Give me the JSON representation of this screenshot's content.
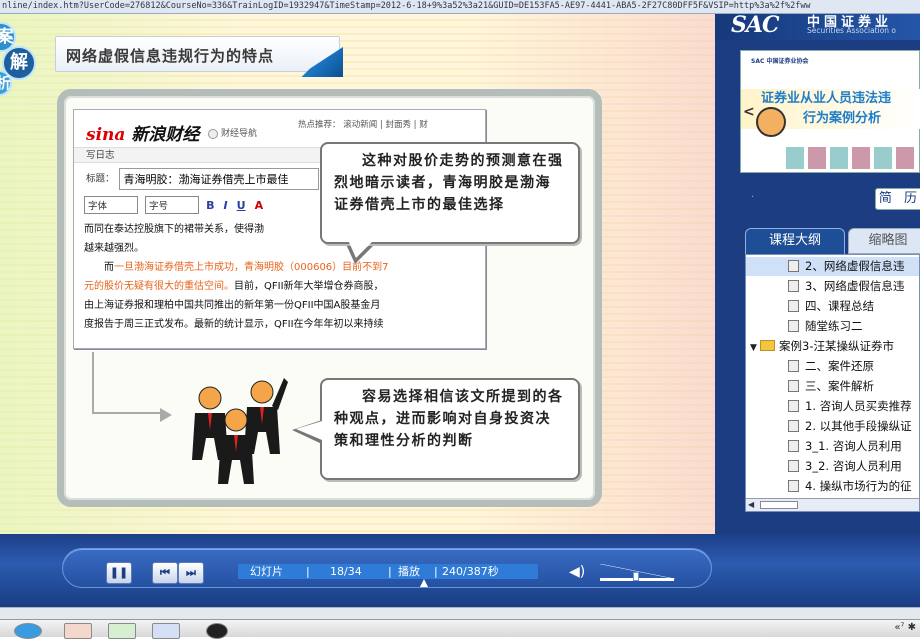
{
  "browser": {
    "url": "nline/index.htm?UserCode=276812&CourseNo=336&TrainLogID=1932947&TimeStamp=2012-6-18+9%3a52%3a21&GUID=DE153FA5-AE97-4441-ABA5-2F27C80DFF5F&VSIP=http%3a%2f%2fww"
  },
  "slide": {
    "case_chars": [
      "案",
      "解",
      "析"
    ],
    "title": "网络虚假信息违规行为的特点",
    "screenshot": {
      "logo_sina": "sina",
      "logo_rest": "新浪财经",
      "fin_nav": "财经导航",
      "hot_links": "热点推荐： 滚动新闻 | 封面秀 | 财",
      "write_blog": "写日志",
      "title_label": "标题：",
      "title_value": "青海明胶：渤海证券借壳上市最佳",
      "font_select": "字体",
      "size_select": "字号",
      "tb_bold": "B",
      "tb_italic": "I",
      "tb_underline": "U",
      "tb_color": "A",
      "line1": "而同在泰达控股旗下的裙带关系，使得渤",
      "line2": "越来越强烈。",
      "line3_pre": "而",
      "line3_red": "一旦渤海证券借壳上市成功，青海明胶（000606）目前不到7",
      "line4_red": "元的股价无疑有很大的重估空间。",
      "line4_rest": "目前，QFII新年大举增仓券商股，",
      "line5": "由上海证券报和理柏中国共同推出的新年第一份QFII中国A股基金月",
      "line6": "度报告于周三正式发布。最新的统计显示，QFII在今年年初以来持续"
    },
    "callout1": "这种对股价走势的预测意在强烈地暗示读者，青海明胶是渤海证券借壳上市的最佳选择",
    "callout2": "容易选择相信该文所提到的各种观点，进而影响对自身投资决策和理性分析的判断"
  },
  "sidebar": {
    "sac_logo": "SAC",
    "sac_cn": "中国证券业",
    "sac_en": "Securities Association o",
    "thumb_small": "SAC 中国证券业协会",
    "thumb_title1": "证券业从业人员违法违",
    "thumb_title2": "行为案例分析",
    "prev_arrow": "<",
    "simple_btn": "简 历",
    "dot": "·",
    "tab_outline": "课程大纲",
    "tab_thumbs": "缩略图",
    "tree": [
      {
        "label": "2、网络虚假信息违",
        "type": "page",
        "indent": 1,
        "highlight": true
      },
      {
        "label": "3、网络虚假信息违",
        "type": "page",
        "indent": 1,
        "highlight": false
      },
      {
        "label": "四、课程总结",
        "type": "page",
        "indent": 1,
        "highlight": false
      },
      {
        "label": "随堂练习二",
        "type": "page",
        "indent": 1,
        "highlight": false
      },
      {
        "label": "案例3-汪某操纵证券市",
        "type": "folder",
        "indent": 0,
        "highlight": false
      },
      {
        "label": "二、案件还原",
        "type": "page",
        "indent": 1,
        "highlight": false
      },
      {
        "label": "三、案件解析",
        "type": "page",
        "indent": 1,
        "highlight": false
      },
      {
        "label": "1. 咨询人员买卖推荐",
        "type": "page",
        "indent": 1,
        "highlight": false
      },
      {
        "label": "2. 以其他手段操纵证",
        "type": "page",
        "indent": 1,
        "highlight": false
      },
      {
        "label": "3_1. 咨询人员利用",
        "type": "page",
        "indent": 1,
        "highlight": false
      },
      {
        "label": "3_2. 咨询人员利用",
        "type": "page",
        "indent": 1,
        "highlight": false
      },
      {
        "label": "4. 操纵市场行为的征",
        "type": "page",
        "indent": 1,
        "highlight": false
      }
    ]
  },
  "player": {
    "pause_label": "❚❚",
    "prev_label": "⏮",
    "next_label": "⏭",
    "slide_label": "幻灯片",
    "slide_counter": "18/34",
    "play_label": "播放",
    "time": "240/387秒",
    "progress_fraction": 0.62,
    "volume_fraction": 0.45
  },
  "taskbar": {
    "tray": "«⁷ ✱"
  }
}
